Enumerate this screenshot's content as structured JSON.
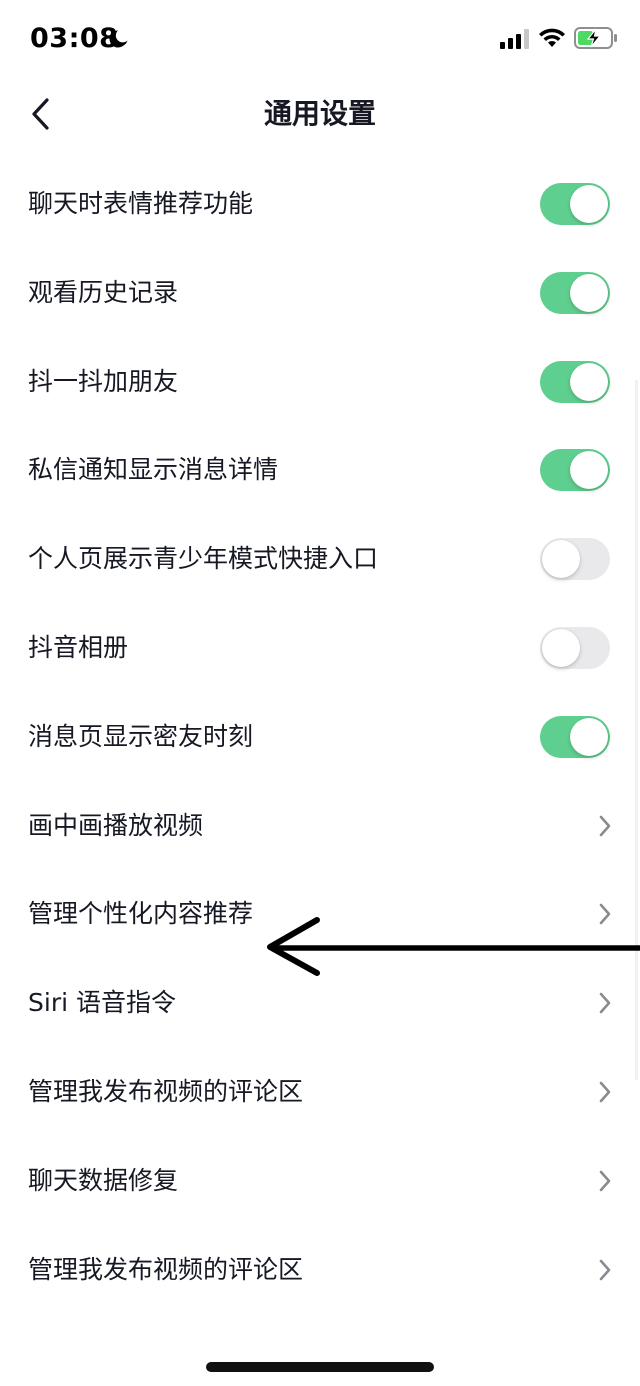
{
  "status_bar": {
    "time": "03:08",
    "icons": [
      "moon-icon",
      "cellular-signal-icon",
      "wifi-icon",
      "battery-charging-icon"
    ]
  },
  "nav": {
    "back_icon": "chevron-left-icon",
    "title": "通用设置"
  },
  "colors": {
    "toggle_on": "#5fcf8f",
    "toggle_off": "#e9e9eb",
    "text": "#161823",
    "chevron": "#8a8b91"
  },
  "settings": {
    "items": [
      {
        "label": "聊天时表情推荐功能",
        "type": "toggle",
        "on": true
      },
      {
        "label": "观看历史记录",
        "type": "toggle",
        "on": true
      },
      {
        "label": "抖一抖加朋友",
        "type": "toggle",
        "on": true
      },
      {
        "label": "私信通知显示消息详情",
        "type": "toggle",
        "on": true
      },
      {
        "label": "个人页展示青少年模式快捷入口",
        "type": "toggle",
        "on": false
      },
      {
        "label": "抖音相册",
        "type": "toggle",
        "on": false
      },
      {
        "label": "消息页显示密友时刻",
        "type": "toggle",
        "on": true
      },
      {
        "label": "画中画播放视频",
        "type": "link"
      },
      {
        "label": "管理个性化内容推荐",
        "type": "link"
      },
      {
        "label": "Siri 语音指令",
        "type": "link"
      },
      {
        "label": "管理我发布视频的评论区",
        "type": "link"
      },
      {
        "label": "聊天数据修复",
        "type": "link"
      },
      {
        "label": "管理我发布视频的评论区",
        "type": "link"
      }
    ]
  },
  "annotation": {
    "icon": "left-arrow-annotation"
  }
}
